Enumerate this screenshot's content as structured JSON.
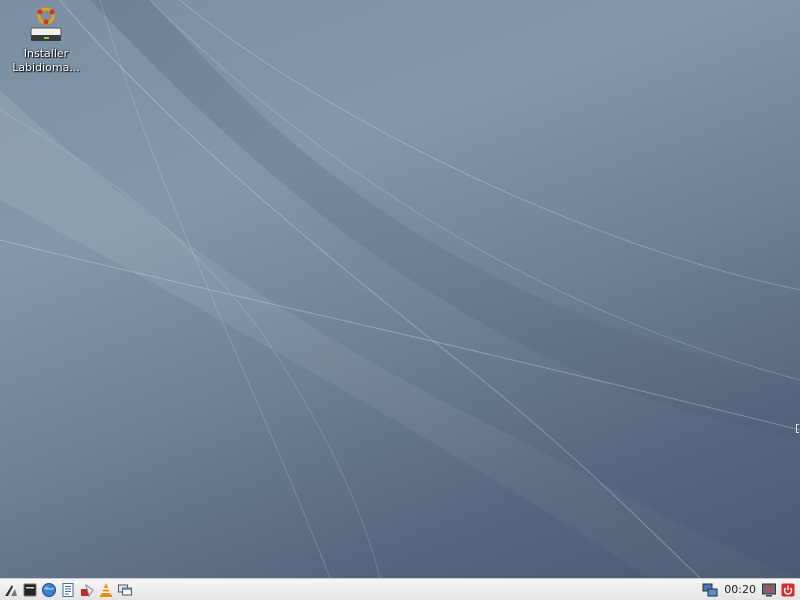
{
  "desktop": {
    "icons": [
      {
        "label_line1": "Installer",
        "label_line2": "Labidioma...",
        "icon": "installer-icon"
      }
    ]
  },
  "taskbar": {
    "launchers": [
      {
        "name": "menu-icon"
      },
      {
        "name": "terminal-icon"
      },
      {
        "name": "browser-icon"
      },
      {
        "name": "text-editor-icon"
      },
      {
        "name": "media-icon"
      },
      {
        "name": "vlc-icon"
      },
      {
        "name": "windows-icon"
      }
    ],
    "clock": "00:20",
    "tray": [
      "network-icon",
      "display-icon",
      "power-icon"
    ]
  },
  "colors": {
    "desktop_top": "#8398ab",
    "desktop_bottom": "#4a5a72",
    "taskbar": "#eeeeee"
  }
}
